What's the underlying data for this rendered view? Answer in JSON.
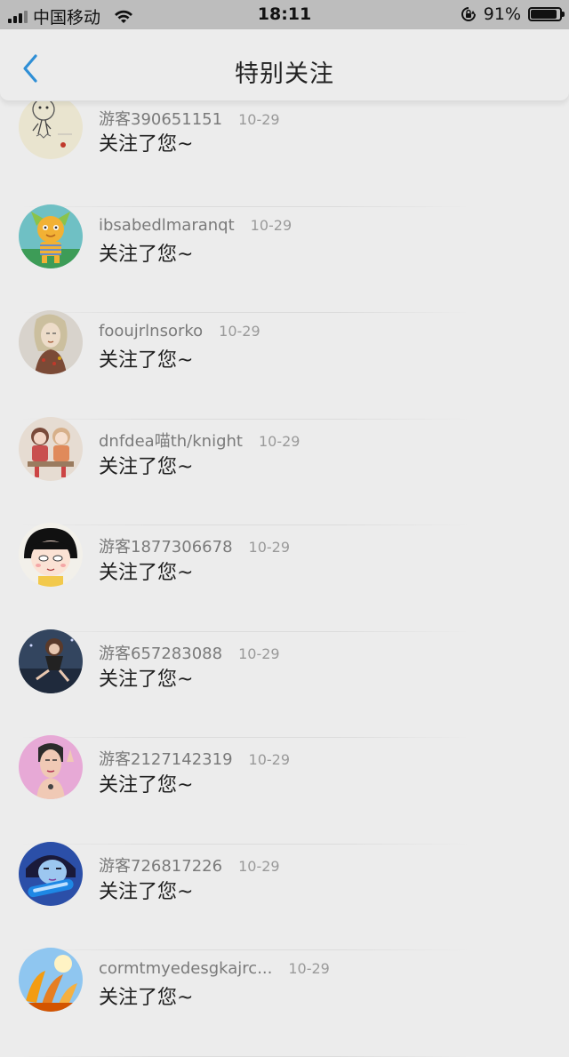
{
  "status_bar": {
    "carrier": "中国移动",
    "time": "18:11",
    "battery_percent": "91%",
    "battery_level": 0.91
  },
  "nav": {
    "title": "特别关注",
    "back_icon": "chevron-left-icon",
    "accent_color": "#2f8fd6"
  },
  "notifications": [
    {
      "username": "游客390651151",
      "date": "10-29",
      "message": "关注了您~",
      "avatar": "sketch-figure"
    },
    {
      "username": "ibsabedlmaranqt",
      "date": "10-29",
      "message": "关注了您~",
      "avatar": "cartoon-cat"
    },
    {
      "username": "fooujrlnsorko",
      "date": "10-29",
      "message": "关注了您~",
      "avatar": "illustrated-girl"
    },
    {
      "username": "dnfdea喵th/knight",
      "date": "10-29",
      "message": "关注了您~",
      "avatar": "anime-pair"
    },
    {
      "username": "游客1877306678",
      "date": "10-29",
      "message": "关注了您~",
      "avatar": "chibi-maruko"
    },
    {
      "username": "游客657283088",
      "date": "10-29",
      "message": "关注了您~",
      "avatar": "sitting-girl"
    },
    {
      "username": "游客2127142319",
      "date": "10-29",
      "message": "关注了您~",
      "avatar": "pink-portrait"
    },
    {
      "username": "游客726817226",
      "date": "10-29",
      "message": "关注了您~",
      "avatar": "blue-face"
    },
    {
      "username": "cormtmyedesgkajrc...",
      "date": "10-29",
      "message": "关注了您~",
      "avatar": "orange-flowers"
    }
  ]
}
